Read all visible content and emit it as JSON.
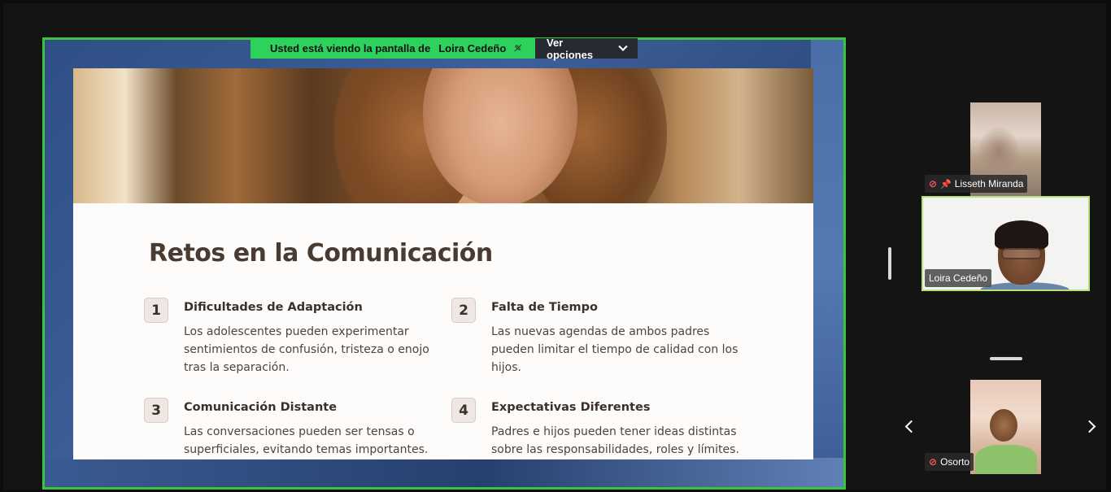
{
  "share_banner": {
    "viewing_text": "Usted está viendo la pantalla de",
    "presenter": "Loira Cedeño",
    "options_label": "Ver opciones"
  },
  "slide": {
    "title": "Retos en la Comunicación",
    "items": [
      {
        "number": "1",
        "heading": "Dificultades de Adaptación",
        "text": "Los adolescentes pueden experimentar sentimientos de confusión, tristeza o enojo tras la separación."
      },
      {
        "number": "2",
        "heading": "Falta de Tiempo",
        "text": "Las nuevas agendas de ambos padres pueden limitar el tiempo de calidad con los hijos."
      },
      {
        "number": "3",
        "heading": "Comunicación Distante",
        "text": "Las conversaciones pueden ser tensas o superficiales, evitando temas importantes."
      },
      {
        "number": "4",
        "heading": "Expectativas Diferentes",
        "text": "Padres e hijos pueden tener ideas distintas sobre las responsabilidades, roles y límites."
      }
    ]
  },
  "participants": [
    {
      "name": "Lisseth Miranda",
      "muted": true,
      "pinned": true
    },
    {
      "name": "Loira Cedeño",
      "muted": false,
      "pinned": false,
      "active_speaker": true
    },
    {
      "name": "Osorto",
      "muted": true,
      "pinned": false
    }
  ],
  "icons": {
    "mic_off": "muted-mic-icon",
    "pin": "pin-icon",
    "chevron": "chevron-down-icon",
    "prev": "chevron-left-icon",
    "next": "chevron-right-icon"
  },
  "colors": {
    "share_border": "#3cc43c",
    "banner_green": "#2fd15d",
    "banner_dark": "#262b33",
    "speaker_border": "#b7e07a",
    "mute_red": "#ff5a5a"
  }
}
